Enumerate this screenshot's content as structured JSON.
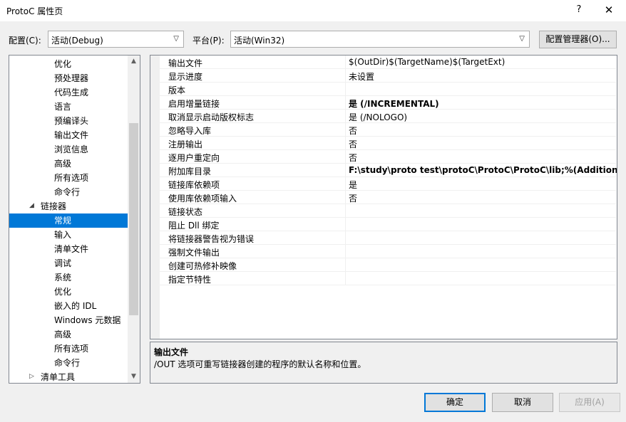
{
  "window": {
    "title": "ProtoC 属性页",
    "help_glyph": "?",
    "close_glyph": "✕"
  },
  "config": {
    "label": "配置(C):",
    "value": "活动(Debug)"
  },
  "platform": {
    "label": "平台(P):",
    "value": "活动(Win32)"
  },
  "config_manager_label": "配置管理器(O)...",
  "tree": {
    "items": [
      {
        "label": "优化",
        "indent": 2
      },
      {
        "label": "预处理器",
        "indent": 2
      },
      {
        "label": "代码生成",
        "indent": 2
      },
      {
        "label": "语言",
        "indent": 2
      },
      {
        "label": "预编译头",
        "indent": 2
      },
      {
        "label": "输出文件",
        "indent": 2
      },
      {
        "label": "浏览信息",
        "indent": 2
      },
      {
        "label": "高级",
        "indent": 2
      },
      {
        "label": "所有选项",
        "indent": 2
      },
      {
        "label": "命令行",
        "indent": 2
      },
      {
        "label": "链接器",
        "indent": 1,
        "expander": "expanded"
      },
      {
        "label": "常规",
        "indent": 2,
        "selected": true
      },
      {
        "label": "输入",
        "indent": 2
      },
      {
        "label": "清单文件",
        "indent": 2
      },
      {
        "label": "调试",
        "indent": 2
      },
      {
        "label": "系统",
        "indent": 2
      },
      {
        "label": "优化",
        "indent": 2
      },
      {
        "label": "嵌入的 IDL",
        "indent": 2
      },
      {
        "label": "Windows 元数据",
        "indent": 2
      },
      {
        "label": "高级",
        "indent": 2
      },
      {
        "label": "所有选项",
        "indent": 2
      },
      {
        "label": "命令行",
        "indent": 2
      },
      {
        "label": "清单工具",
        "indent": 1,
        "expander": "collapsed"
      }
    ]
  },
  "properties": [
    {
      "name": "输出文件",
      "value": "$(OutDir)$(TargetName)$(TargetExt)",
      "bold": false
    },
    {
      "name": "显示进度",
      "value": "未设置",
      "bold": false
    },
    {
      "name": "版本",
      "value": "",
      "bold": false
    },
    {
      "name": "启用增量链接",
      "value": "是 (/INCREMENTAL)",
      "bold": true
    },
    {
      "name": "取消显示启动版权标志",
      "value": "是 (/NOLOGO)",
      "bold": false
    },
    {
      "name": "忽略导入库",
      "value": "否",
      "bold": false
    },
    {
      "name": "注册输出",
      "value": "否",
      "bold": false
    },
    {
      "name": "逐用户重定向",
      "value": "否",
      "bold": false
    },
    {
      "name": "附加库目录",
      "value": "F:\\study\\proto test\\protoC\\ProtoC\\ProtoC\\lib;%(AdditionalLi",
      "bold": true
    },
    {
      "name": "链接库依赖项",
      "value": "是",
      "bold": false
    },
    {
      "name": "使用库依赖项输入",
      "value": "否",
      "bold": false
    },
    {
      "name": "链接状态",
      "value": "",
      "bold": false
    },
    {
      "name": "阻止 Dll 绑定",
      "value": "",
      "bold": false
    },
    {
      "name": "将链接器警告视为错误",
      "value": "",
      "bold": false
    },
    {
      "name": "强制文件输出",
      "value": "",
      "bold": false
    },
    {
      "name": "创建可热修补映像",
      "value": "",
      "bold": false
    },
    {
      "name": "指定节特性",
      "value": "",
      "bold": false
    }
  ],
  "description": {
    "title": "输出文件",
    "text": "/OUT 选项可重写链接器创建的程序的默认名称和位置。"
  },
  "buttons": {
    "ok": "确定",
    "cancel": "取消",
    "apply": "应用(A)"
  },
  "icons": {
    "expanded": "◢",
    "collapsed": "▷",
    "scroll_up": "▲",
    "scroll_down": "▼",
    "dropdown": "▽"
  }
}
